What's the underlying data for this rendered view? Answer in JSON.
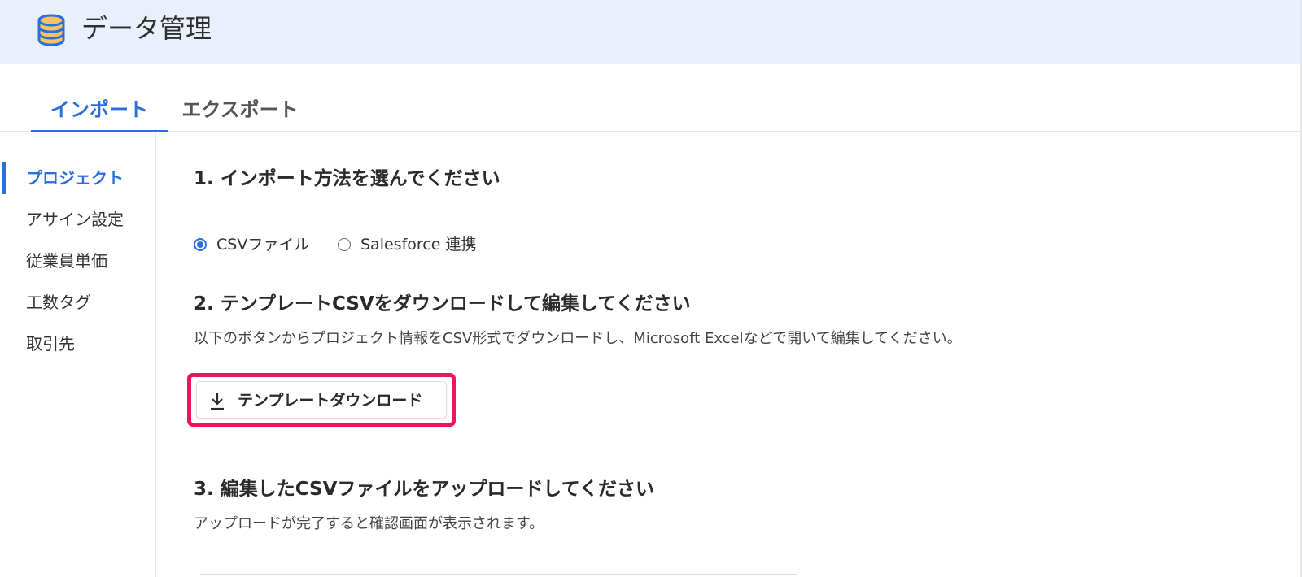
{
  "header": {
    "title": "データ管理",
    "icon": "database-icon",
    "background_color": "#e9effb",
    "icon_colors": {
      "fill": "#f7c266",
      "stroke": "#2a6fdb"
    }
  },
  "tabs": [
    {
      "label": "インポート",
      "active": true
    },
    {
      "label": "エクスポート",
      "active": false
    }
  ],
  "sidebar": {
    "items": [
      {
        "label": "プロジェクト",
        "active": true
      },
      {
        "label": "アサイン設定",
        "active": false
      },
      {
        "label": "従業員単価",
        "active": false
      },
      {
        "label": "工数タグ",
        "active": false
      },
      {
        "label": "取引先",
        "active": false
      }
    ]
  },
  "main": {
    "step1": {
      "title": "1. インポート方法を選んでください",
      "options": [
        {
          "label": "CSVファイル",
          "selected": true
        },
        {
          "label": "Salesforce 連携",
          "selected": false
        }
      ]
    },
    "step2": {
      "title": "2. テンプレートCSVをダウンロードして編集してください",
      "description": "以下のボタンからプロジェクト情報をCSV形式でダウンロードし、Microsoft Excelなどで開いて編集してください。",
      "button_label": "テンプレートダウンロード",
      "button_icon": "download-icon",
      "highlight_color": "#e8185e"
    },
    "step3": {
      "title": "3. 編集したCSVファイルをアップロードしてください",
      "description": "アップロードが完了すると確認画面が表示されます。"
    }
  },
  "colors": {
    "accent": "#2a6fdb",
    "text": "#333333"
  }
}
